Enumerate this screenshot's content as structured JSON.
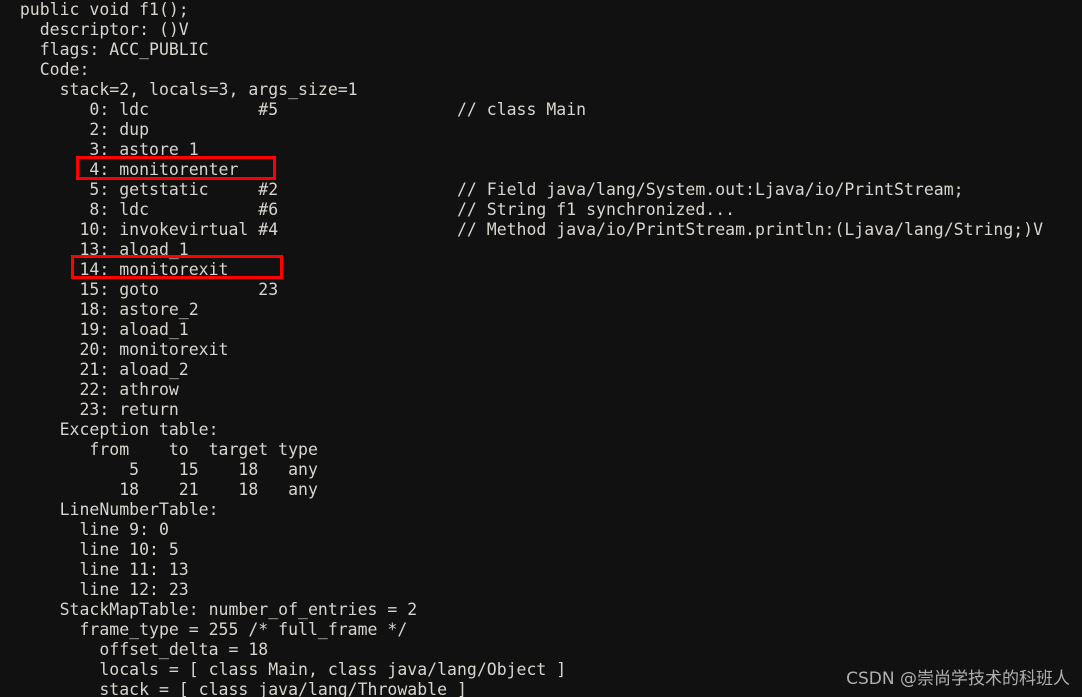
{
  "terminal": {
    "background_color": "#111111",
    "text_color": "#d8d4cf",
    "highlight_color": "#ff0000",
    "lines": [
      "  public void f1();",
      "    descriptor: ()V",
      "    flags: ACC_PUBLIC",
      "    Code:",
      "      stack=2, locals=3, args_size=1",
      "         0: ldc           #5                  // class Main",
      "         2: dup",
      "         3: astore_1",
      "         4: monitorenter",
      "         5: getstatic     #2                  // Field java/lang/System.out:Ljava/io/PrintStream;",
      "         8: ldc           #6                  // String f1 synchronized...",
      "        10: invokevirtual #4                  // Method java/io/PrintStream.println:(Ljava/lang/String;)V",
      "        13: aload_1",
      "        14: monitorexit",
      "        15: goto          23",
      "        18: astore_2",
      "        19: aload_1",
      "        20: monitorexit",
      "        21: aload_2",
      "        22: athrow",
      "        23: return",
      "      Exception table:",
      "         from    to  target type",
      "             5    15    18   any",
      "            18    21    18   any",
      "      LineNumberTable:",
      "        line 9: 0",
      "        line 10: 5",
      "        line 11: 13",
      "        line 12: 23",
      "      StackMapTable: number_of_entries = 2",
      "        frame_type = 255 /* full_frame */",
      "          offset_delta = 18",
      "          locals = [ class Main, class java/lang/Object ]",
      "          stack = [ class java/lang/Throwable ]"
    ]
  },
  "highlights": [
    {
      "name": "monitorenter-highlight",
      "label": "4: monitorenter"
    },
    {
      "name": "monitorexit-highlight",
      "label": "14: monitorexit"
    }
  ],
  "watermark": {
    "text": "CSDN @崇尚学技术的科班人"
  }
}
